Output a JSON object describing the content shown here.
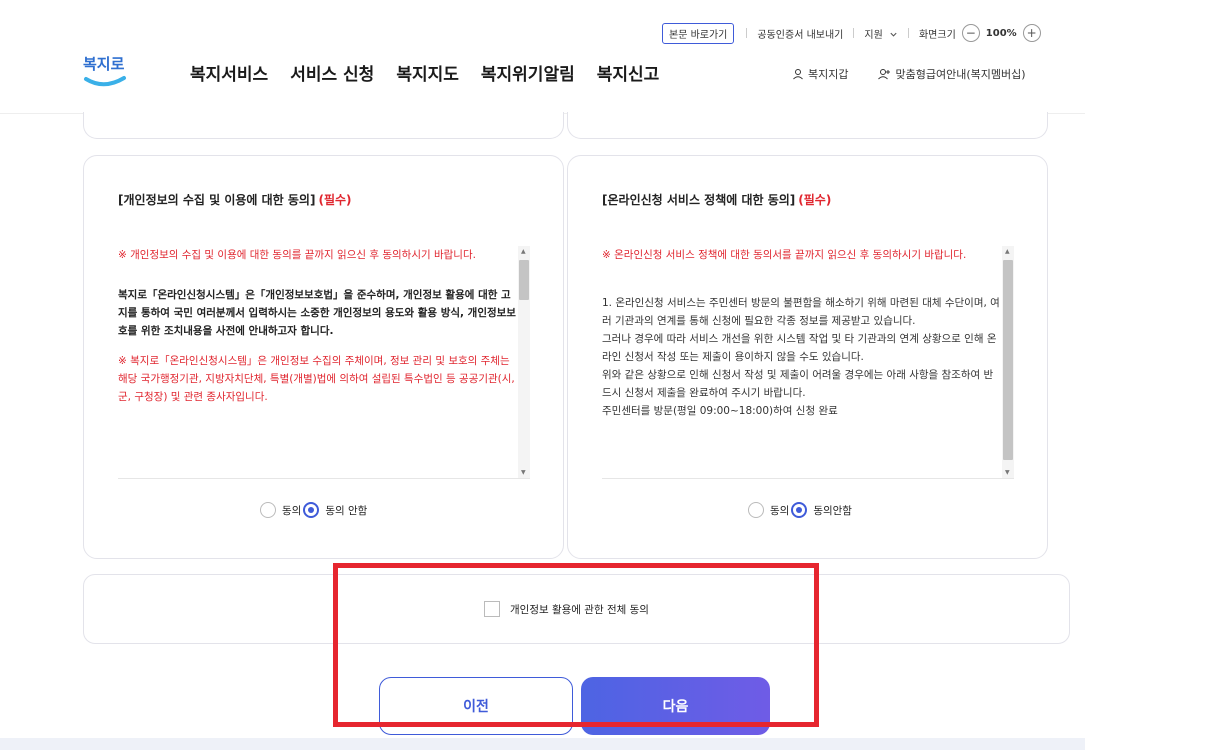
{
  "util": {
    "skip_link": "본문 바로가기",
    "cert_export": "공동인증서 내보내기",
    "support": "지원",
    "screen_size": "화면크기",
    "zoom_out": "−",
    "zoom_value": "100%",
    "zoom_in": "+"
  },
  "logo": {
    "text": "복지로"
  },
  "gnb": [
    "복지서비스",
    "서비스 신청",
    "복지지도",
    "복지위기알림",
    "복지신고"
  ],
  "header_right": {
    "wallet": "복지지갑",
    "membership": "맞춤형급여안내(복지멤버십)"
  },
  "cards": {
    "privacy": {
      "title": "[개인정보의 수집 및 이용에 대한 동의]",
      "required": "(필수)",
      "notice": "※ 개인정보의 수집 및 이용에 대한 동의를 끝까지 읽으신 후 동의하시기 바랍니다.",
      "body": "복지로「온라인신청시스템」은「개인정보보호법」을 준수하며, 개인정보 활용에 대한 고지를 통하여 국민 여러분께서 입력하시는 소중한 개인정보의 용도와 활용 방식, 개인정보보호를 위한 조치내용을 사전에 안내하고자 합니다.",
      "subject": "※ 복지로「온라인신청시스템」은 개인정보 수집의 주체이며, 정보 관리 및 보호의 주체는 해당 국가행정기관, 지방자치단체, 특별(개별)법에 의하여 설립된 특수법인 등 공공기관(시, 군, 구청장) 및 관련 종사자입니다.",
      "agree": "동의",
      "disagree": "동의 안함",
      "selected": "disagree"
    },
    "online": {
      "title": "[온라인신청 서비스 정책에 대한 동의]",
      "required": "(필수)",
      "notice": "※ 온라인신청 서비스 정책에 대한 동의서를 끝까지 읽으신 후 동의하시기 바랍니다.",
      "lines": [
        "1. 온라인신청 서비스는 주민센터 방문의 불편함을 해소하기 위해 마련된 대체 수단이며, 여러 기관과의 연계를 통해 신청에 필요한 각종 정보를 제공받고 있습니다.",
        "그러나 경우에 따라 서비스 개선을 위한 시스템 작업 및 타 기관과의 연계 상황으로 인해 온라인 신청서 작성 또는 제출이 용이하지 않을 수도 있습니다.",
        "위와 같은 상황으로 인해 신청서 작성 및 제출이 어려울 경우에는 아래 사항을 참조하여 반드시 신청서 제출을 완료하여 주시기 바랍니다.",
        "주민센터를 방문(평일 09:00~18:00)하여 신청 완료"
      ],
      "agree": "동의",
      "disagree": "동의안함",
      "selected": "disagree"
    }
  },
  "agree_all": {
    "label": "개인정보 활용에 관한 전체 동의",
    "checked": false
  },
  "buttons": {
    "prev": "이전",
    "next": "다음"
  },
  "colors": {
    "accent": "#3f5bd9",
    "required": "#e0262f",
    "highlight": "#e6262f"
  }
}
